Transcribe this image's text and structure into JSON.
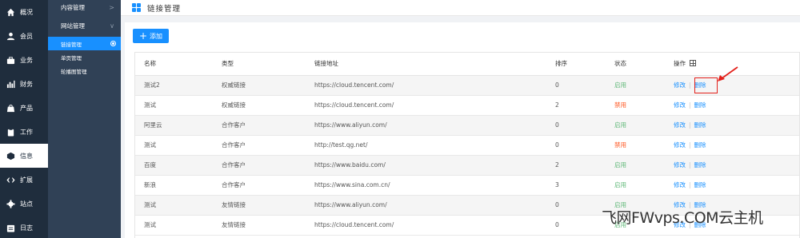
{
  "rail": [
    {
      "label": "概况",
      "icon": "home-icon",
      "active": false
    },
    {
      "label": "会员",
      "icon": "user-icon",
      "active": false
    },
    {
      "label": "业务",
      "icon": "briefcase-icon",
      "active": false
    },
    {
      "label": "财务",
      "icon": "bar-chart-icon",
      "active": false
    },
    {
      "label": "产品",
      "icon": "shopping-bag-icon",
      "active": false
    },
    {
      "label": "工作",
      "icon": "clipboard-icon",
      "active": false
    },
    {
      "label": "信息",
      "icon": "cube-icon",
      "active": true
    },
    {
      "label": "扩展",
      "icon": "code-icon",
      "active": false
    },
    {
      "label": "站点",
      "icon": "gear-icon",
      "active": false
    },
    {
      "label": "日志",
      "icon": "calendar-icon",
      "active": false
    }
  ],
  "submenu": {
    "group1": {
      "label": "内容管理",
      "chevron": ">"
    },
    "group2": {
      "label": "网站管理",
      "chevron": "∨"
    },
    "items": [
      {
        "label": "链接管理",
        "active": true
      },
      {
        "label": "单页管理",
        "active": false
      },
      {
        "label": "轮播图管理",
        "active": false
      }
    ]
  },
  "header": {
    "title": "链接管理"
  },
  "toolbar": {
    "add_label": "添加",
    "add_plus": "+"
  },
  "table": {
    "columns": {
      "name": "名称",
      "type": "类型",
      "url": "链接地址",
      "sort": "排序",
      "status": "状态",
      "ops": "操作"
    },
    "edit_label": "修改",
    "delete_label": "删除",
    "sep": "|",
    "rows": [
      {
        "name": "测试2",
        "type": "权威链接",
        "url": "https://cloud.tencent.com/",
        "sort": "0",
        "status": "启用",
        "enabled": true
      },
      {
        "name": "测试",
        "type": "权威链接",
        "url": "https://cloud.tencent.com/",
        "sort": "2",
        "status": "禁用",
        "enabled": false
      },
      {
        "name": "阿里云",
        "type": "合作客户",
        "url": "https://www.aliyun.com/",
        "sort": "0",
        "status": "启用",
        "enabled": true
      },
      {
        "name": "测试",
        "type": "合作客户",
        "url": "http://test.qg.net/",
        "sort": "0",
        "status": "禁用",
        "enabled": false
      },
      {
        "name": "百度",
        "type": "合作客户",
        "url": "https://www.baidu.com/",
        "sort": "2",
        "status": "启用",
        "enabled": true
      },
      {
        "name": "新浪",
        "type": "合作客户",
        "url": "https://www.sina.com.cn/",
        "sort": "3",
        "status": "启用",
        "enabled": true
      },
      {
        "name": "测试",
        "type": "友情链接",
        "url": "https://www.aliyun.com/",
        "sort": "0",
        "status": "启用",
        "enabled": true
      },
      {
        "name": "测试",
        "type": "友情链接",
        "url": "https://cloud.tencent.com/",
        "sort": "0",
        "status": "启用",
        "enabled": true
      }
    ]
  },
  "watermark": "飞网FWvps.COM云主机",
  "colors": {
    "primary": "#1890ff",
    "enabled": "#5fb878",
    "disabled": "#ff5722",
    "rail_bg": "#1f2d3d",
    "submenu_bg": "#304156",
    "highlight": "#e3201b"
  }
}
